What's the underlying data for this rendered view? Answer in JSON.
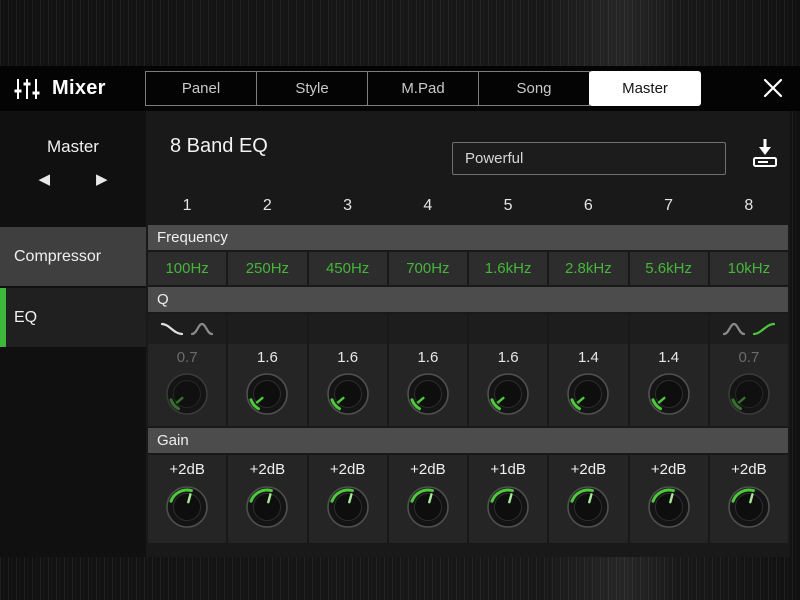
{
  "header": {
    "title": "Mixer",
    "tabs": [
      {
        "label": "Panel",
        "active": false
      },
      {
        "label": "Style",
        "active": false
      },
      {
        "label": "M.Pad",
        "active": false
      },
      {
        "label": "Song",
        "active": false
      },
      {
        "label": "Master",
        "active": true
      }
    ]
  },
  "sidebar": {
    "group_label": "Master",
    "prev_icon": "◀",
    "next_icon": "▶",
    "items": [
      {
        "label": "Compressor",
        "selected": false
      },
      {
        "label": "EQ",
        "selected": true
      }
    ]
  },
  "main": {
    "title": "8 Band EQ",
    "preset": "Powerful",
    "section_labels": {
      "frequency": "Frequency",
      "q": "Q",
      "gain": "Gain"
    },
    "bands": [
      {
        "number": "1",
        "frequency": "100Hz",
        "q": "0.7",
        "q_enabled": false,
        "gain": "+2dB",
        "mode": "low-shelf"
      },
      {
        "number": "2",
        "frequency": "250Hz",
        "q": "1.6",
        "q_enabled": true,
        "gain": "+2dB",
        "mode": "peak"
      },
      {
        "number": "3",
        "frequency": "450Hz",
        "q": "1.6",
        "q_enabled": true,
        "gain": "+2dB",
        "mode": "peak"
      },
      {
        "number": "4",
        "frequency": "700Hz",
        "q": "1.6",
        "q_enabled": true,
        "gain": "+2dB",
        "mode": "peak"
      },
      {
        "number": "5",
        "frequency": "1.6kHz",
        "q": "1.6",
        "q_enabled": true,
        "gain": "+1dB",
        "mode": "peak"
      },
      {
        "number": "6",
        "frequency": "2.8kHz",
        "q": "1.4",
        "q_enabled": true,
        "gain": "+2dB",
        "mode": "peak"
      },
      {
        "number": "7",
        "frequency": "5.6kHz",
        "q": "1.4",
        "q_enabled": true,
        "gain": "+2dB",
        "mode": "peak"
      },
      {
        "number": "8",
        "frequency": "10kHz",
        "q": "0.7",
        "q_enabled": false,
        "gain": "+2dB",
        "mode": "high-shelf"
      }
    ]
  },
  "icons": {
    "app": "mixer-sliders-icon",
    "close": "close-x-icon",
    "save": "save-download-icon",
    "low_shelf": "low-shelf-curve-icon",
    "peak": "peak-curve-icon",
    "high_shelf": "high-shelf-curve-icon"
  },
  "colors": {
    "accent_green": "#4ec93c",
    "value_green": "#46b53a",
    "selected_item_stripe": "#3db83d",
    "section_bar": "#4c4c4c",
    "tab_active_bg": "#ffffff"
  }
}
